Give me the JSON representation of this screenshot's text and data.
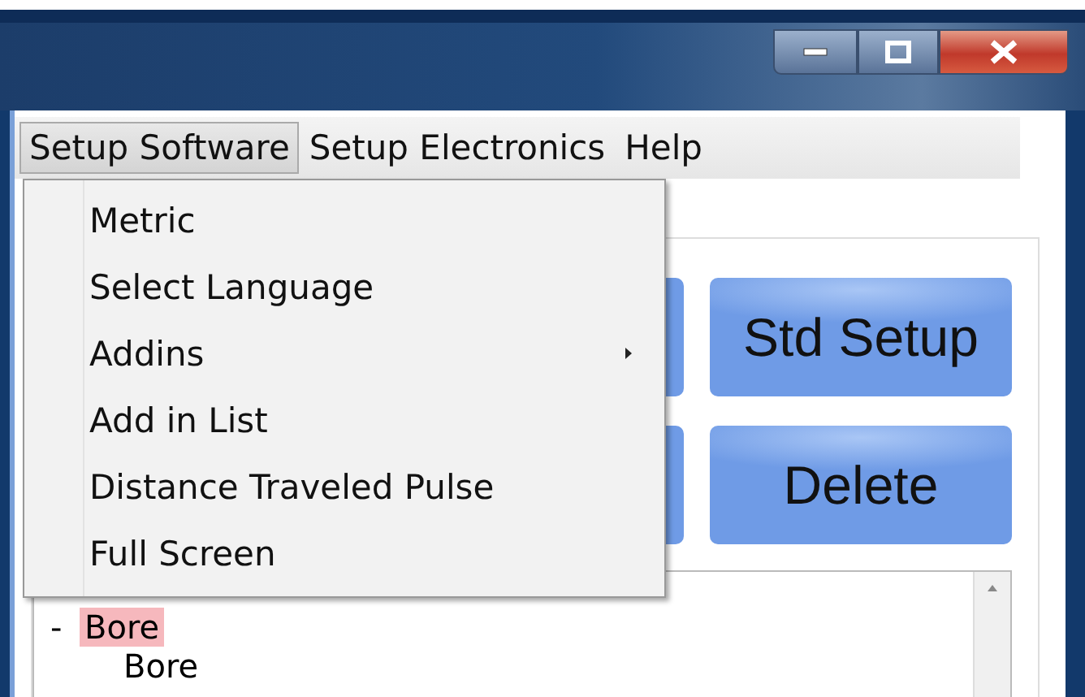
{
  "menu_bar": [
    {
      "label": "Setup Software",
      "selected": true
    },
    {
      "label": "Setup Electronics",
      "selected": false
    },
    {
      "label": "Help",
      "selected": false
    }
  ],
  "dropdown": [
    {
      "label": "Metric",
      "submenu": false
    },
    {
      "label": "Select Language",
      "submenu": false
    },
    {
      "label": "Addins",
      "submenu": true
    },
    {
      "label": "Add in List",
      "submenu": false
    },
    {
      "label": "Distance Traveled Pulse",
      "submenu": false
    },
    {
      "label": "Full Screen",
      "submenu": false
    }
  ],
  "buttons": [
    "Std Setup",
    "Delete"
  ],
  "tree": [
    {
      "label": "Bore",
      "toggle": "-",
      "expanded": true,
      "highlighted": true,
      "children": [
        {
          "label": "Bore",
          "highlighted": false
        }
      ]
    }
  ]
}
